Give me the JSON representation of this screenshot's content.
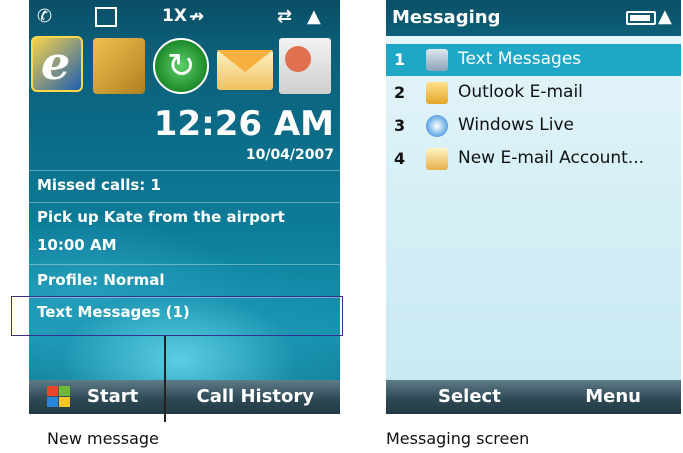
{
  "left_screen": {
    "status_icons": [
      "phone-call-icon",
      "sim-icon",
      "1x-icon",
      "no-data-icon",
      "sync-icon",
      "signal-icon"
    ],
    "status_1x": "1X",
    "app_icons": [
      "internet-explorer-icon",
      "settings-icon",
      "activesync-icon",
      "messaging-icon",
      "contacts-icon"
    ],
    "clock": "12:26 AM",
    "date": "10/04/2007",
    "items": {
      "missed_calls": "Missed calls: 1",
      "appointment": "Pick up Kate from the airport",
      "appointment_time": "10:00 AM",
      "profile": "Profile: Normal",
      "text_messages": "Text Messages (1)"
    },
    "soft_keys": {
      "left": "Start",
      "right": "Call History"
    }
  },
  "right_screen": {
    "title": "Messaging",
    "items": [
      {
        "number": "1",
        "label": "Text Messages",
        "icon": "sms-icon",
        "selected": true
      },
      {
        "number": "2",
        "label": "Outlook E-mail",
        "icon": "outlook-icon",
        "selected": false
      },
      {
        "number": "3",
        "label": "Windows Live",
        "icon": "windows-live-icon",
        "selected": false
      },
      {
        "number": "4",
        "label": "New E-mail Account...",
        "icon": "new-email-icon",
        "selected": false
      }
    ],
    "soft_keys": {
      "left": "Select",
      "right": "Menu"
    }
  },
  "captions": {
    "left": "New message",
    "right": "Messaging screen"
  },
  "colors": {
    "today_background": "#0c7c99",
    "selection": "#1fa7c8",
    "highlight_box": "#3a2d8f"
  }
}
